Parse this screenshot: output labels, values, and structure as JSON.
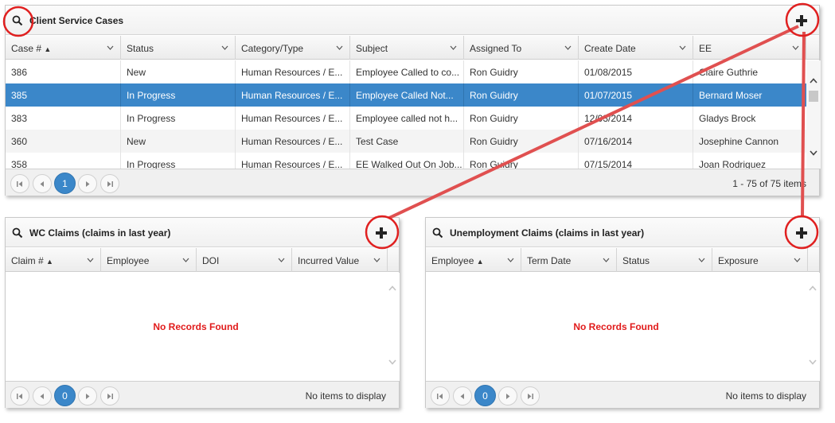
{
  "client_cases": {
    "title": "Client Service Cases",
    "columns": [
      "Case #",
      "Status",
      "Category/Type",
      "Subject",
      "Assigned To",
      "Create Date",
      "EE"
    ],
    "sorted_column_marker": "▲",
    "rows": [
      [
        "386",
        "New",
        "Human Resources / E...",
        "Employee Called to co...",
        "Ron Guidry",
        "01/08/2015",
        "Claire Guthrie"
      ],
      [
        "385",
        "In Progress",
        "Human Resources / E...",
        "Employee Called Not...",
        "Ron Guidry",
        "01/07/2015",
        "Bernard Moser"
      ],
      [
        "383",
        "In Progress",
        "Human Resources / E...",
        "Employee called not h...",
        "Ron Guidry",
        "12/03/2014",
        "Gladys Brock"
      ],
      [
        "360",
        "New",
        "Human Resources / E...",
        "Test Case",
        "Ron Guidry",
        "07/16/2014",
        "Josephine Cannon"
      ],
      [
        "358",
        "In Progress",
        "Human Resources / E...",
        "EE Walked Out On Job...",
        "Ron Guidry",
        "07/15/2014",
        "Joan Rodriguez"
      ]
    ],
    "selected_row": 1,
    "current_page": "1",
    "pager_info": "1 - 75 of 75 items"
  },
  "wc_claims": {
    "title": "WC Claims (claims in last year)",
    "columns": [
      "Claim #",
      "Employee",
      "DOI",
      "Incurred Value"
    ],
    "empty_message": "No Records Found",
    "current_page": "0",
    "pager_info": "No items to display"
  },
  "unemployment_claims": {
    "title": "Unemployment Claims (claims in last year)",
    "columns": [
      "Employee",
      "Term Date",
      "Status",
      "Exposure"
    ],
    "empty_message": "No Records Found",
    "current_page": "0",
    "pager_info": "No items to display"
  },
  "colors": {
    "selection": "#3b87c9",
    "empty_message": "#e11b1b",
    "annotation": "#e02020",
    "callout_line": "#e05050"
  },
  "icons": [
    "search-icon",
    "plus-icon",
    "chevron-down-icon",
    "sort-up-icon",
    "scroll-up-icon",
    "scroll-down-icon",
    "first-page-icon",
    "prev-page-icon",
    "next-page-icon",
    "last-page-icon"
  ]
}
